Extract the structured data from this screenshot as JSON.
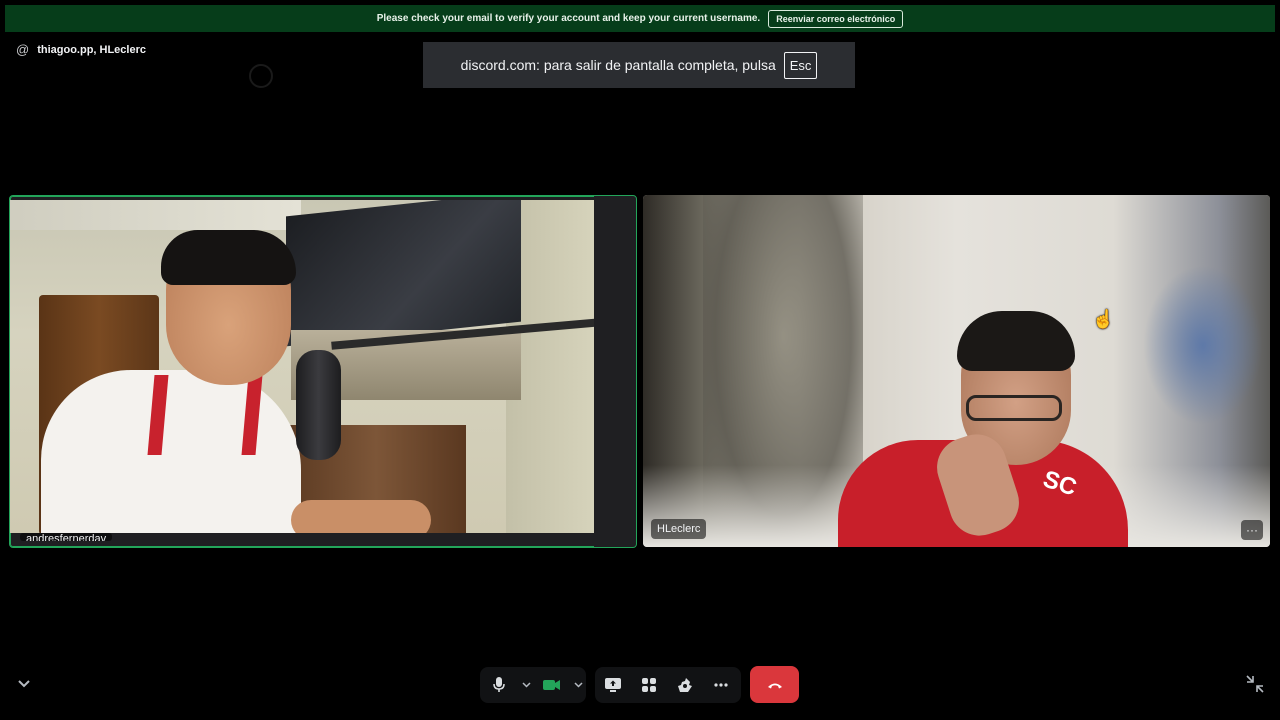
{
  "notice": {
    "text": "Please check your email to verify your account and keep your current username.",
    "button_label": "Reenviar correo electrónico"
  },
  "call": {
    "participants_label": "thiagoo.pp, HLeclerc"
  },
  "fullscreen_toast": {
    "text": "discord.com: para salir de pantalla completa, pulsa",
    "key_label": "Esc"
  },
  "tiles": [
    {
      "name_tag": "andresfernerdav",
      "speaking": true
    },
    {
      "name_tag": "HLeclerc",
      "speaking": false
    }
  ],
  "controls": {
    "more_label": "···"
  },
  "colors": {
    "notice_bg": "#063d1a",
    "speaking_border": "#23a55a",
    "hangup": "#da373c",
    "control_bg": "#111214"
  },
  "icons": [
    "at-icon",
    "microphone-icon",
    "camera-icon",
    "screen-share-icon",
    "activities-icon",
    "soundboard-icon",
    "more-icon",
    "hang-up-icon",
    "chevron-down-icon",
    "exit-fullscreen-icon"
  ]
}
